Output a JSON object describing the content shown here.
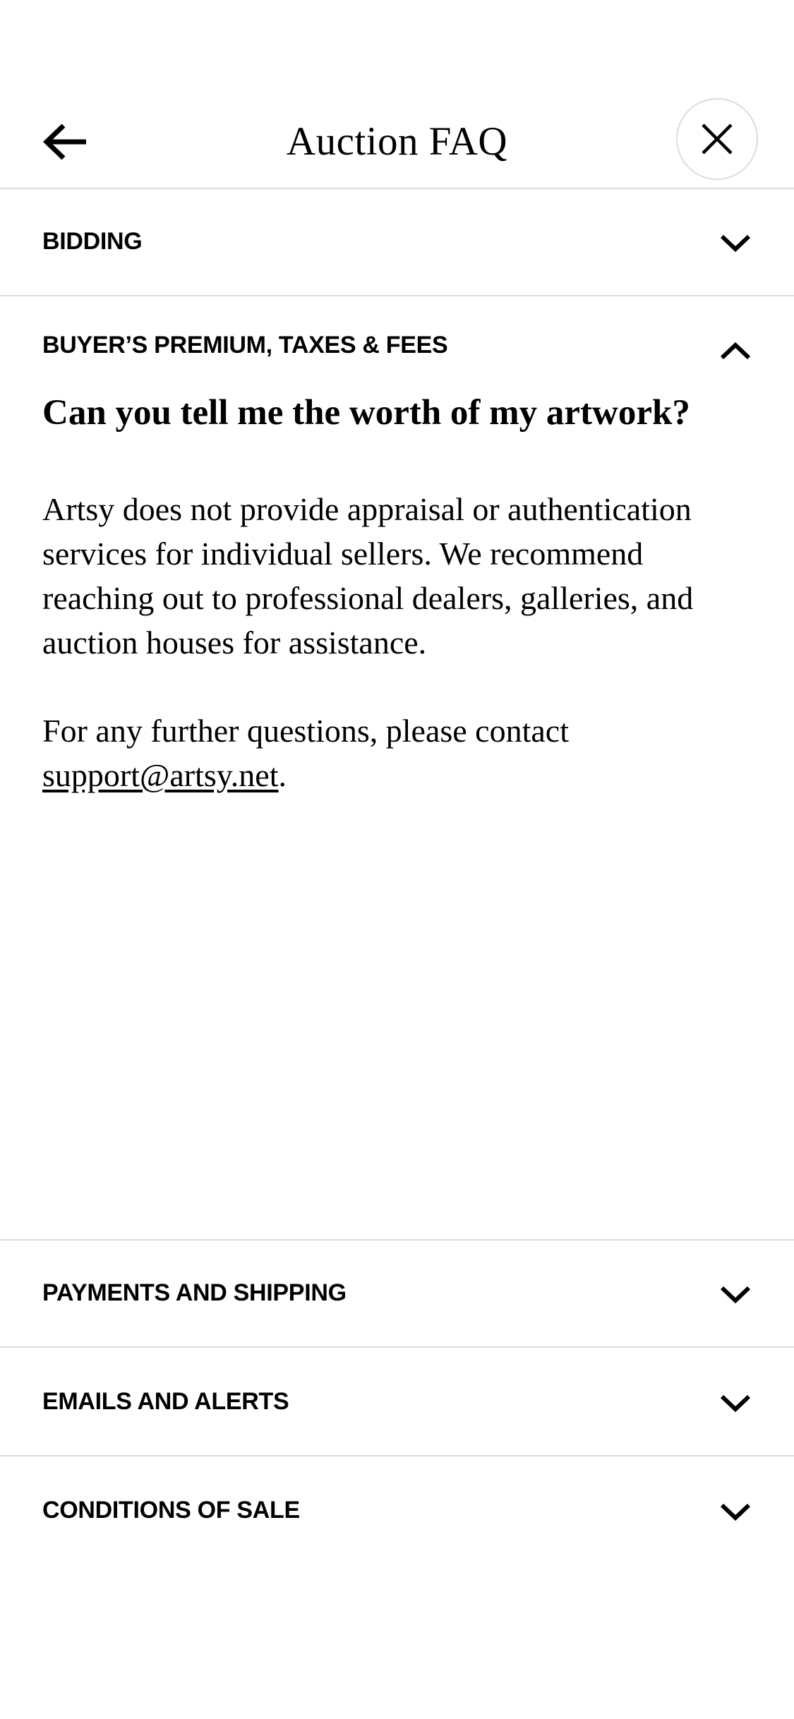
{
  "header": {
    "title": "Auction FAQ",
    "back_icon": "arrow-left-icon",
    "close_icon": "close-icon"
  },
  "sections": [
    {
      "label": "BIDDING",
      "expanded": false
    },
    {
      "label": "BUYER’S PREMIUM, TAXES & FEES",
      "expanded": true,
      "question": "Can you tell me the worth of my artwork?",
      "answer_paragraph_1": "Artsy does not provide appraisal or authentication services for individual sellers. We recommend reaching out to professional dealers, galleries, and auction houses for assistance.",
      "answer_paragraph_2_prefix": "For any further questions, please contact ",
      "support_email": "support@artsy.net",
      "answer_paragraph_2_suffix": "."
    },
    {
      "label": "PAYMENTS AND SHIPPING",
      "expanded": false
    },
    {
      "label": "EMAILS AND ALERTS",
      "expanded": false
    },
    {
      "label": "CONDITIONS OF SALE",
      "expanded": false
    }
  ]
}
